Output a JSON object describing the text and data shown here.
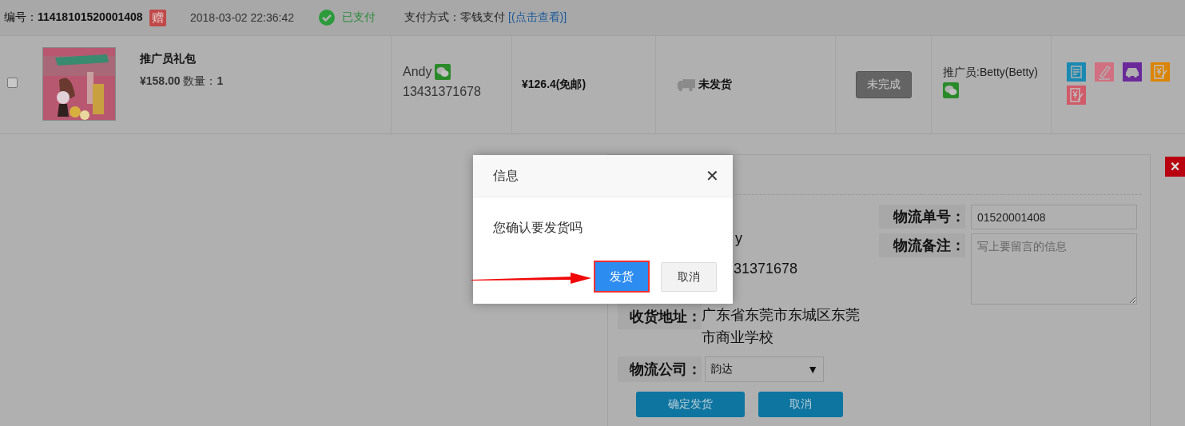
{
  "order": {
    "number": "编号：**11418101520001408**",
    "gift_badge": "赠",
    "time": "2018-03-02 22:36:42",
    "status": "已支付",
    "payment": "支付方式：零钱支付",
    "payment_link": "[(点击查看)]"
  },
  "item": {
    "checked": false,
    "kind": "picture",
    "name": "推广员礼包",
    "price_qty": "**¥158.00** 数量：**1**",
    "buyer": "Andy",
    "phone": "13431371678",
    "amount": "¥126.4(免邮)",
    "shipping": "未发货",
    "state_button": "未完成",
    "promoter": "推广员:Betty(Betty)",
    "actions": [
      {
        "kind": "note",
        "color": "#1a8ab2"
      },
      {
        "kind": "pencil",
        "color": "#d07080"
      },
      {
        "kind": "car",
        "color": "#6a2a9a"
      },
      {
        "kind": "yen",
        "color": "#dc8400"
      },
      {
        "kind": "yen",
        "color": "#d05a68"
      }
    ]
  },
  "ship_form": {
    "fragments": [
      "y",
      "31371678"
    ],
    "address_label": "收货地址：",
    "address": "广东省东莞市东城区东莞市商业学校",
    "company_label": "物流公司：",
    "company": "韵达",
    "caret": "▼",
    "confirm": "确定发货",
    "cancel": "取消",
    "tracking_label": "物流单号：",
    "tracking": "01520001408",
    "note_label": "物流备注：",
    "note_placeholder": "写上要留言的信息",
    "close": "×"
  },
  "dialog": {
    "title": "信息",
    "close": "✕",
    "message": "您确认要发货吗",
    "confirm": "发货",
    "cancel": "取消"
  }
}
